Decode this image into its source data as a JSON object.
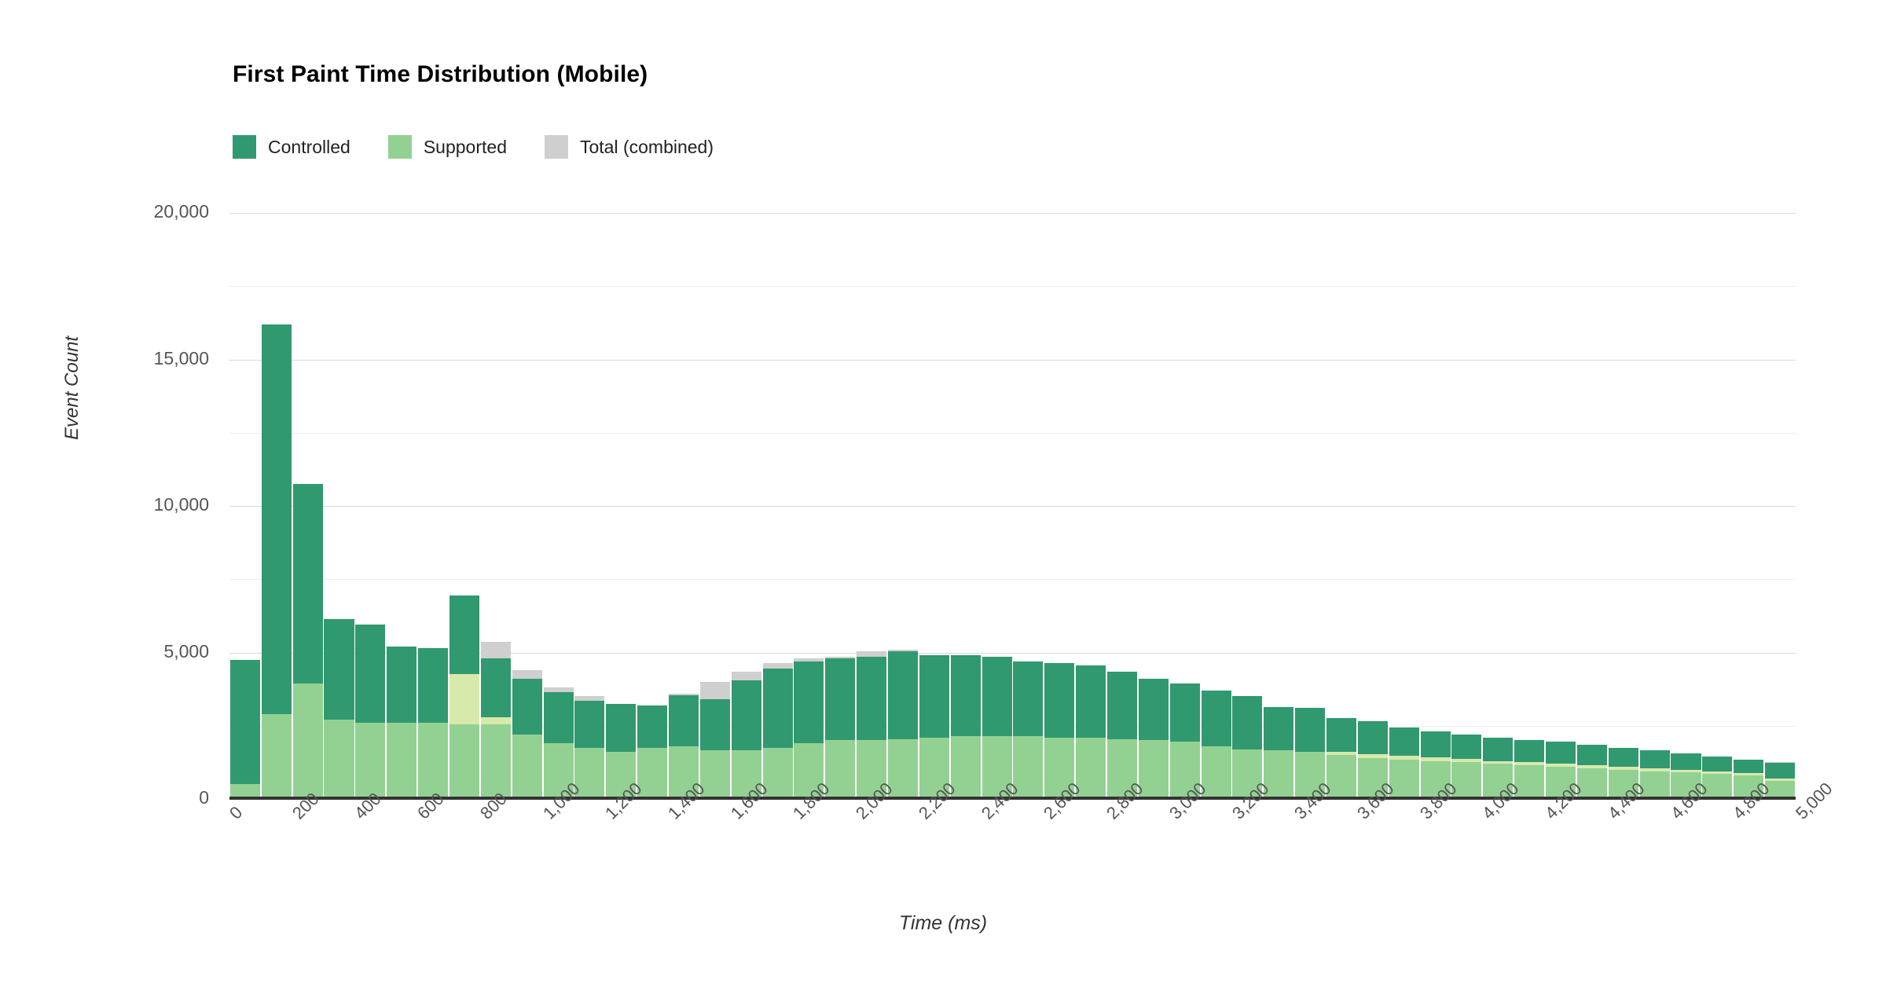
{
  "chart_data": {
    "type": "bar",
    "subtype": "overlaid-stacked-histogram",
    "title": "First Paint Time Distribution (Mobile)",
    "xlabel": "Time (ms)",
    "ylabel": "Event Count",
    "xlim": [
      0,
      5000
    ],
    "ylim": [
      0,
      20000
    ],
    "bin_width": 100,
    "grid": true,
    "legend_position": "top-left",
    "y_ticks": [
      0,
      5000,
      10000,
      15000,
      20000
    ],
    "y_tick_labels": [
      "0",
      "5,000",
      "10,000",
      "15,000",
      "20,000"
    ],
    "y_minor_ticks": [
      2500,
      7500,
      12500,
      17500
    ],
    "x_ticks": [
      0,
      200,
      400,
      600,
      800,
      1000,
      1200,
      1400,
      1600,
      1800,
      2000,
      2200,
      2400,
      2600,
      2800,
      3000,
      3200,
      3400,
      3600,
      3800,
      4000,
      4200,
      4400,
      4600,
      4800,
      5000
    ],
    "x_tick_labels": [
      "0",
      "200",
      "400",
      "600",
      "800",
      "1,000",
      "1,200",
      "1,400",
      "1,600",
      "1,800",
      "2,000",
      "2,200",
      "2,400",
      "2,600",
      "2,800",
      "3,000",
      "3,200",
      "3,400",
      "3,600",
      "3,800",
      "4,000",
      "4,200",
      "4,400",
      "4,600",
      "4,800",
      "5,000"
    ],
    "x_bin_starts": [
      0,
      100,
      200,
      300,
      400,
      500,
      600,
      700,
      800,
      900,
      1000,
      1100,
      1200,
      1300,
      1400,
      1500,
      1600,
      1700,
      1800,
      1900,
      2000,
      2100,
      2200,
      2300,
      2400,
      2500,
      2600,
      2700,
      2800,
      2900,
      3000,
      3100,
      3200,
      3300,
      3400,
      3500,
      3600,
      3700,
      3800,
      3900,
      4000,
      4100,
      4200,
      4300,
      4400,
      4500,
      4600,
      4700,
      4800,
      4900
    ],
    "colors": {
      "controlled": "#31996f",
      "supported": "#93d193",
      "total": "#cfcfcf",
      "overlap": "#d7e9ab",
      "gridline": "#d9d9d9",
      "gridline_minor": "#eeeeee",
      "axis": "#333333",
      "text": "#555555",
      "title": "#000000"
    },
    "series": [
      {
        "name": "Controlled",
        "color": "#31996f",
        "values": [
          4300,
          13400,
          6950,
          3600,
          3350,
          2700,
          2700,
          2750,
          2250,
          1900,
          1750,
          1600,
          1700,
          1800,
          1750,
          1750,
          2400,
          2700,
          2800,
          2800,
          2850,
          3000,
          3000,
          2900,
          2850,
          2800,
          2700,
          2600,
          2550,
          2450,
          2350,
          2000,
          1800,
          1700,
          1600,
          1450,
          1350,
          1250,
          1200,
          1150,
          1100,
          1050,
          1000,
          950,
          900,
          880,
          850,
          800,
          750,
          620
        ]
      },
      {
        "name": "Supported",
        "color": "#93d193",
        "values": [
          500,
          2900,
          3950,
          2700,
          2600,
          2600,
          2600,
          4250,
          2550,
          2200,
          1900,
          1750,
          1600,
          1750,
          1800,
          1650,
          1650,
          1750,
          1900,
          2000,
          2000,
          2050,
          2100,
          2150,
          2150,
          2150,
          2100,
          2100,
          2050,
          2000,
          1950,
          1800,
          1700,
          1650,
          1600,
          1500,
          1400,
          1350,
          1300,
          1250,
          1200,
          1150,
          1100,
          1050,
          1000,
          950,
          900,
          850,
          800,
          620
        ]
      },
      {
        "name": "Total (combined)",
        "color": "#cfcfcf",
        "values": [
          4750,
          16200,
          10750,
          6150,
          5950,
          5200,
          5150,
          6950,
          5350,
          4400,
          3800,
          3500,
          3250,
          3200,
          3600,
          4000,
          4350,
          4650,
          4800,
          4850,
          5050,
          5100,
          4900,
          4900,
          4850,
          4700,
          4650,
          4550,
          4350,
          4100,
          3950,
          3700,
          3500,
          3150,
          3100,
          2750,
          2650,
          2450,
          2300,
          2200,
          2100,
          2000,
          1950,
          1850,
          1750,
          1650,
          1550,
          1450,
          1350,
          1250
        ]
      }
    ]
  },
  "legend": {
    "items": [
      {
        "label": "Controlled",
        "color": "#31996f",
        "swatch_name": "legend-swatch-controlled"
      },
      {
        "label": "Supported",
        "color": "#93d193",
        "swatch_name": "legend-swatch-supported"
      },
      {
        "label": "Total (combined)",
        "color": "#cfcfcf",
        "swatch_name": "legend-swatch-total"
      }
    ]
  }
}
